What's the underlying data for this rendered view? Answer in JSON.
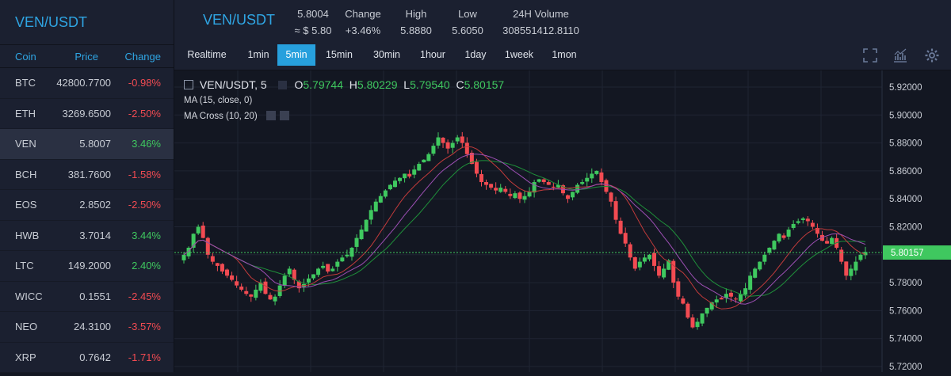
{
  "sidebar": {
    "title": "VEN/USDT",
    "headers": {
      "coin": "Coin",
      "price": "Price",
      "change": "Change"
    },
    "rows": [
      {
        "coin": "BTC",
        "price": "42800.7700",
        "change": "-0.98%",
        "dir": "neg"
      },
      {
        "coin": "ETH",
        "price": "3269.6500",
        "change": "-2.50%",
        "dir": "neg"
      },
      {
        "coin": "VEN",
        "price": "5.8007",
        "change": "3.46%",
        "dir": "pos",
        "active": true
      },
      {
        "coin": "BCH",
        "price": "381.7600",
        "change": "-1.58%",
        "dir": "neg"
      },
      {
        "coin": "EOS",
        "price": "2.8502",
        "change": "-2.50%",
        "dir": "neg"
      },
      {
        "coin": "HWB",
        "price": "3.7014",
        "change": "3.44%",
        "dir": "pos"
      },
      {
        "coin": "LTC",
        "price": "149.2000",
        "change": "2.40%",
        "dir": "pos"
      },
      {
        "coin": "WICC",
        "price": "0.1551",
        "change": "-2.45%",
        "dir": "neg"
      },
      {
        "coin": "NEO",
        "price": "24.3100",
        "change": "-3.57%",
        "dir": "neg"
      },
      {
        "coin": "XRP",
        "price": "0.7642",
        "change": "-1.71%",
        "dir": "neg"
      }
    ]
  },
  "ticker": {
    "pair": "VEN/USDT",
    "price": "5.8004",
    "usd_price": "≈ $ 5.80",
    "change_label": "Change",
    "change_value": "+3.46%",
    "high_label": "High",
    "high_value": "5.8880",
    "low_label": "Low",
    "low_value": "5.6050",
    "volume_label": "24H Volume",
    "volume_value": "308551412.8110"
  },
  "timeframes": [
    "Realtime",
    "1min",
    "5min",
    "15min",
    "30min",
    "1hour",
    "1day",
    "1week",
    "1mon"
  ],
  "active_timeframe": "5min",
  "tool_icons": [
    "fullscreen-icon",
    "indicators-icon",
    "settings-gear-icon"
  ],
  "legend": {
    "symbol": "VEN/USDT, 5",
    "o_label": "O",
    "o_value": "5.79744",
    "h_label": "H",
    "h_value": "5.80229",
    "l_label": "L",
    "l_value": "5.79540",
    "c_label": "C",
    "c_value": "5.80157",
    "indicator_1": "MA (15, close, 0)",
    "indicator_2": "MA Cross (10, 20)"
  },
  "colors": {
    "up": "#3fc85f",
    "down": "#f24b52",
    "ma": "#9c4fb3",
    "cross_fast": "#c23b3b",
    "cross_slow": "#1f8f3a",
    "accent": "#2fa5e3"
  },
  "chart_data": {
    "type": "candlestick",
    "y_ticks": [
      "5.92000",
      "5.90000",
      "5.88000",
      "5.86000",
      "5.84000",
      "5.82000",
      "5.80000",
      "5.78000",
      "5.76000",
      "5.74000",
      "5.72000"
    ],
    "ylim": [
      5.72,
      5.925
    ],
    "last_price_label": "5.80157",
    "last_price": 5.80157,
    "close": [
      5.8,
      5.805,
      5.815,
      5.82,
      5.812,
      5.8,
      5.795,
      5.792,
      5.788,
      5.785,
      5.782,
      5.778,
      5.775,
      5.772,
      5.77,
      5.775,
      5.78,
      5.772,
      5.768,
      5.77,
      5.778,
      5.785,
      5.79,
      5.782,
      5.776,
      5.779,
      5.783,
      5.786,
      5.79,
      5.792,
      5.788,
      5.79,
      5.795,
      5.798,
      5.8,
      5.805,
      5.812,
      5.818,
      5.825,
      5.832,
      5.838,
      5.842,
      5.846,
      5.85,
      5.853,
      5.855,
      5.858,
      5.856,
      5.861,
      5.865,
      5.868,
      5.872,
      5.878,
      5.884,
      5.88,
      5.876,
      5.88,
      5.884,
      5.88,
      5.872,
      5.865,
      5.858,
      5.852,
      5.85,
      5.848,
      5.846,
      5.848,
      5.845,
      5.842,
      5.844,
      5.84,
      5.842,
      5.845,
      5.852,
      5.854,
      5.852,
      5.85,
      5.848,
      5.85,
      5.844,
      5.84,
      5.845,
      5.85,
      5.852,
      5.855,
      5.858,
      5.86,
      5.852,
      5.845,
      5.838,
      5.825,
      5.815,
      5.808,
      5.798,
      5.79,
      5.795,
      5.798,
      5.8,
      5.792,
      5.785,
      5.79,
      5.796,
      5.78,
      5.77,
      5.765,
      5.755,
      5.748,
      5.752,
      5.758,
      5.762,
      5.766,
      5.768,
      5.768,
      5.772,
      5.77,
      5.768,
      5.772,
      5.776,
      5.785,
      5.79,
      5.795,
      5.8,
      5.805,
      5.81,
      5.815,
      5.812,
      5.818,
      5.822,
      5.824,
      5.826,
      5.824,
      5.82,
      5.815,
      5.81,
      5.808,
      5.812,
      5.805,
      5.795,
      5.785,
      5.79,
      5.795,
      5.8,
      5.802
    ],
    "min_price_label": "5.72000"
  }
}
